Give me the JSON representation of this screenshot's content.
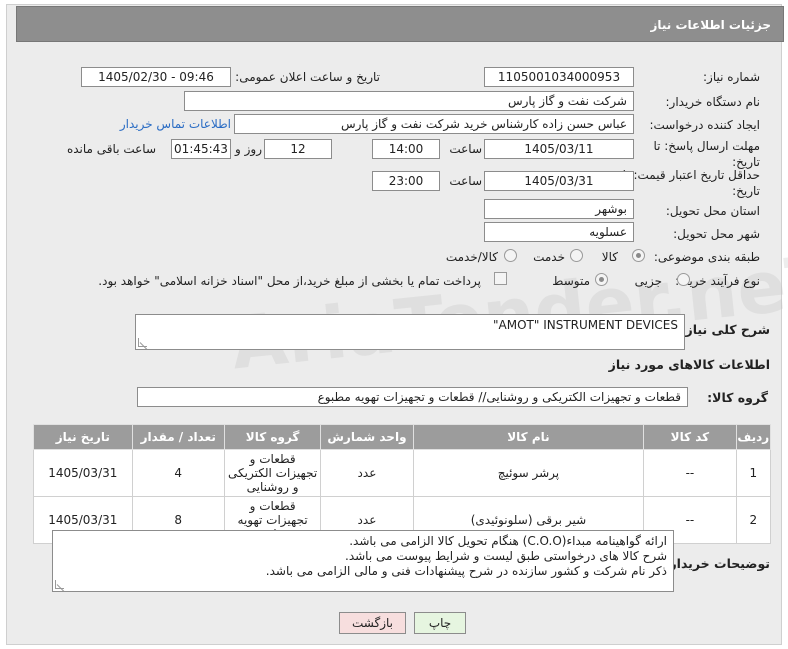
{
  "header": {
    "title": "جزئیات اطلاعات نیاز"
  },
  "form": {
    "need_number_label": "شماره نیاز:",
    "need_number": "1105001034000953",
    "announce_label": "تاریخ و ساعت اعلان عمومی:",
    "announce_value": "1405/02/30 - 09:46",
    "buyer_org_label": "نام دستگاه خریدار:",
    "buyer_org": "شرکت نفت و گاز پارس",
    "creator_label": "ایجاد کننده درخواست:",
    "creator": "عباس حسن زاده کارشناس خرید شرکت نفت و گاز پارس",
    "buyer_contact_link": "اطلاعات تماس خریدار",
    "deadline_label": "مهلت ارسال پاسخ: تا تاریخ:",
    "deadline_date": "1405/03/11",
    "time_label": "ساعت",
    "deadline_time": "14:00",
    "days_value": "12",
    "days_label": "روز و",
    "remaining_value": "01:45:43",
    "remaining_label": "ساعت باقی مانده",
    "validity_label": "حداقل تاریخ اعتبار قیمت: تا تاریخ:",
    "validity_date": "1405/03/31",
    "validity_time": "23:00",
    "province_label": "استان محل تحویل:",
    "province": "بوشهر",
    "city_label": "شهر محل تحویل:",
    "city": "عسلویه",
    "category_label": "طبقه بندی موضوعی:",
    "category_options": [
      "کالا",
      "خدمت",
      "کالا/خدمت"
    ],
    "process_label": "نوع فرآیند خرید :",
    "process_options": [
      "جزیی",
      "متوسط"
    ],
    "payment_note": "پرداخت تمام یا بخشی از مبلغ خرید،از محل \"اسناد خزانه اسلامی\" خواهد بود.",
    "description_label": "شرح کلی نیاز:",
    "description": "\"AMOT\" INSTRUMENT DEVICES",
    "goods_info_title": "اطلاعات کالاهای مورد نیاز",
    "goods_group_label": "گروه کالا:",
    "goods_group": "قطعات و تجهیزات الکتریکی و روشنایی//  قطعات و تجهیزات تهویه مطبوع",
    "buyer_notes_label": "توضیحات خریدار:",
    "buyer_notes": [
      "ارائه گواهینامه مبداء(C.O.O) هنگام تحویل کالا الزامی می باشد.",
      "شرح کالا های درخواستی طبق لیست و شرایط پیوست می باشد.",
      "ذکر نام شرکت و کشور سازنده در شرح پیشنهادات فنی و مالی الزامی می باشد."
    ]
  },
  "table": {
    "headers": [
      "ردیف",
      "کد کالا",
      "نام کالا",
      "واحد شمارش",
      "گروه کالا",
      "تعداد / مقدار",
      "تاریخ نیاز"
    ],
    "rows": [
      [
        "1",
        "--",
        "پرشر سوئیچ",
        "عدد",
        "قطعات و تجهیزات الکتریکی و روشنایی",
        "4",
        "1405/03/31"
      ],
      [
        "2",
        "--",
        "شیر برقی (سلونوئیدی)",
        "عدد",
        "قطعات و تجهیزات تهویه مطبوع",
        "8",
        "1405/03/31"
      ]
    ]
  },
  "buttons": {
    "print": "چاپ",
    "back": "بازگشت"
  },
  "watermark": "AriaTender.neT",
  "colors": {
    "header_bg": "#8e8e8e",
    "link": "#2a6cc4",
    "back_btn_bg": "#f7dede",
    "print_btn_bg": "#e6f5e0"
  }
}
